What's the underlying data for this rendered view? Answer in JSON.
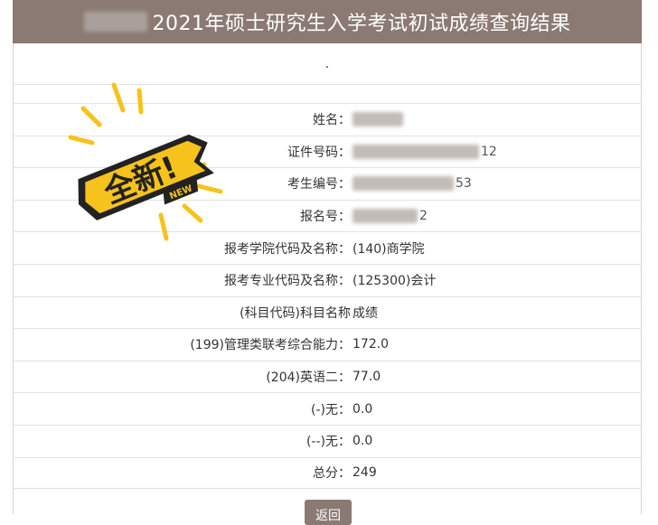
{
  "header": {
    "title": "2021年硕士研究生入学考试初试成绩查询结果"
  },
  "top_mark": ".",
  "sticker": {
    "main_text": "全新!",
    "sub_text": "NEW",
    "colors": {
      "yellow": "#f6c21c",
      "dark": "#222222",
      "ray": "#f6c21c"
    }
  },
  "fields": [
    {
      "label": "姓名：",
      "value": "",
      "redacted": true,
      "tail": ""
    },
    {
      "label": "证件号码：",
      "value": "",
      "redacted": true,
      "tail": "12"
    },
    {
      "label": "考生编号：",
      "value": "",
      "redacted": true,
      "tail": "53"
    },
    {
      "label": "报名号：",
      "value": "",
      "redacted": true,
      "tail": "2"
    },
    {
      "label": "报考学院代码及名称：",
      "value": "(140)商学院"
    },
    {
      "label": "报考专业代码及名称：",
      "value": "(125300)会计"
    },
    {
      "label": "(科目代码)科目名称",
      "value": "成绩"
    },
    {
      "label": "(199)管理类联考综合能力：",
      "value": "172.0"
    },
    {
      "label": "(204)英语二：",
      "value": "77.0"
    },
    {
      "label": "(-)无：",
      "value": "0.0"
    },
    {
      "label": "(--)无：",
      "value": "0.0"
    },
    {
      "label": "总分：",
      "value": "249"
    }
  ],
  "back_button": {
    "label": "返回"
  },
  "colors": {
    "header_bg": "#8a7a73",
    "header_text": "#ffffff",
    "row_border": "#e6e1de",
    "button_bg": "#8a7a73"
  }
}
